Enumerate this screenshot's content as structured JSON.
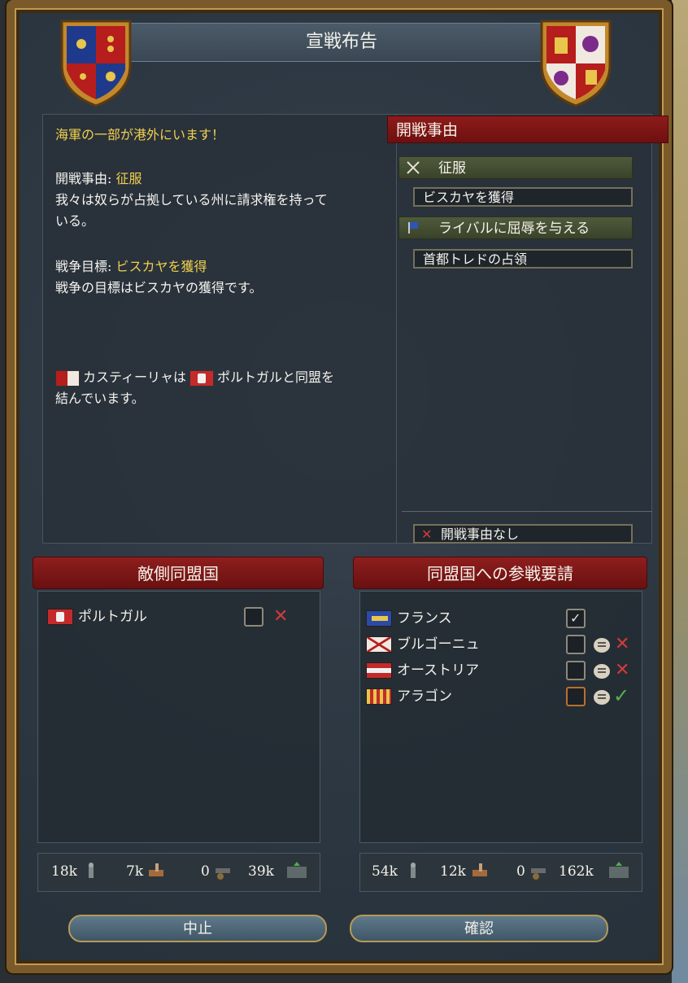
{
  "title": "宣戦布告",
  "left_panel": {
    "warning": "海軍の一部が港外にいます！",
    "cb_label": "開戦事由: ",
    "cb_value": "征服",
    "cb_desc_1": "我々は奴らが占拠している州に請求権を持って",
    "cb_desc_2": "いる。",
    "goal_label": "戦争目標: ",
    "goal_value": "ビスカヤを獲得",
    "goal_desc": "戦争の目標はビスカヤの獲得です。",
    "alliance_1": "カスティーリャは",
    "alliance_2": "ポルトガルと同盟を",
    "alliance_3": "結んでいます。"
  },
  "right_panel": {
    "header": "開戦事由",
    "cb1_title": "征服",
    "cb1_box": "ビスカヤを獲得",
    "cb2_title": "ライバルに屈辱を与える",
    "cb2_box": "首都トレドの占領",
    "no_cb": "開戦事由なし"
  },
  "enemy": {
    "title": "敵側同盟国",
    "allies": [
      {
        "name": "ポルトガル"
      }
    ],
    "stats": {
      "infantry": "18k",
      "cavalry": "7k",
      "artillery": "0",
      "total": "39k"
    }
  },
  "friendly": {
    "title": "同盟国への参戦要請",
    "allies": [
      {
        "name": "フランス"
      },
      {
        "name": "ブルゴーニュ"
      },
      {
        "name": "オーストリア"
      },
      {
        "name": "アラゴン"
      }
    ],
    "stats": {
      "infantry": "54k",
      "cavalry": "12k",
      "artillery": "0",
      "total": "162k"
    }
  },
  "buttons": {
    "cancel": "中止",
    "confirm": "確認"
  },
  "colors": {
    "accent_yellow": "#f1d14f",
    "ribbon_red": "#8e1e1e",
    "check_green": "#5ab04d",
    "x_red": "#d33a3a"
  }
}
